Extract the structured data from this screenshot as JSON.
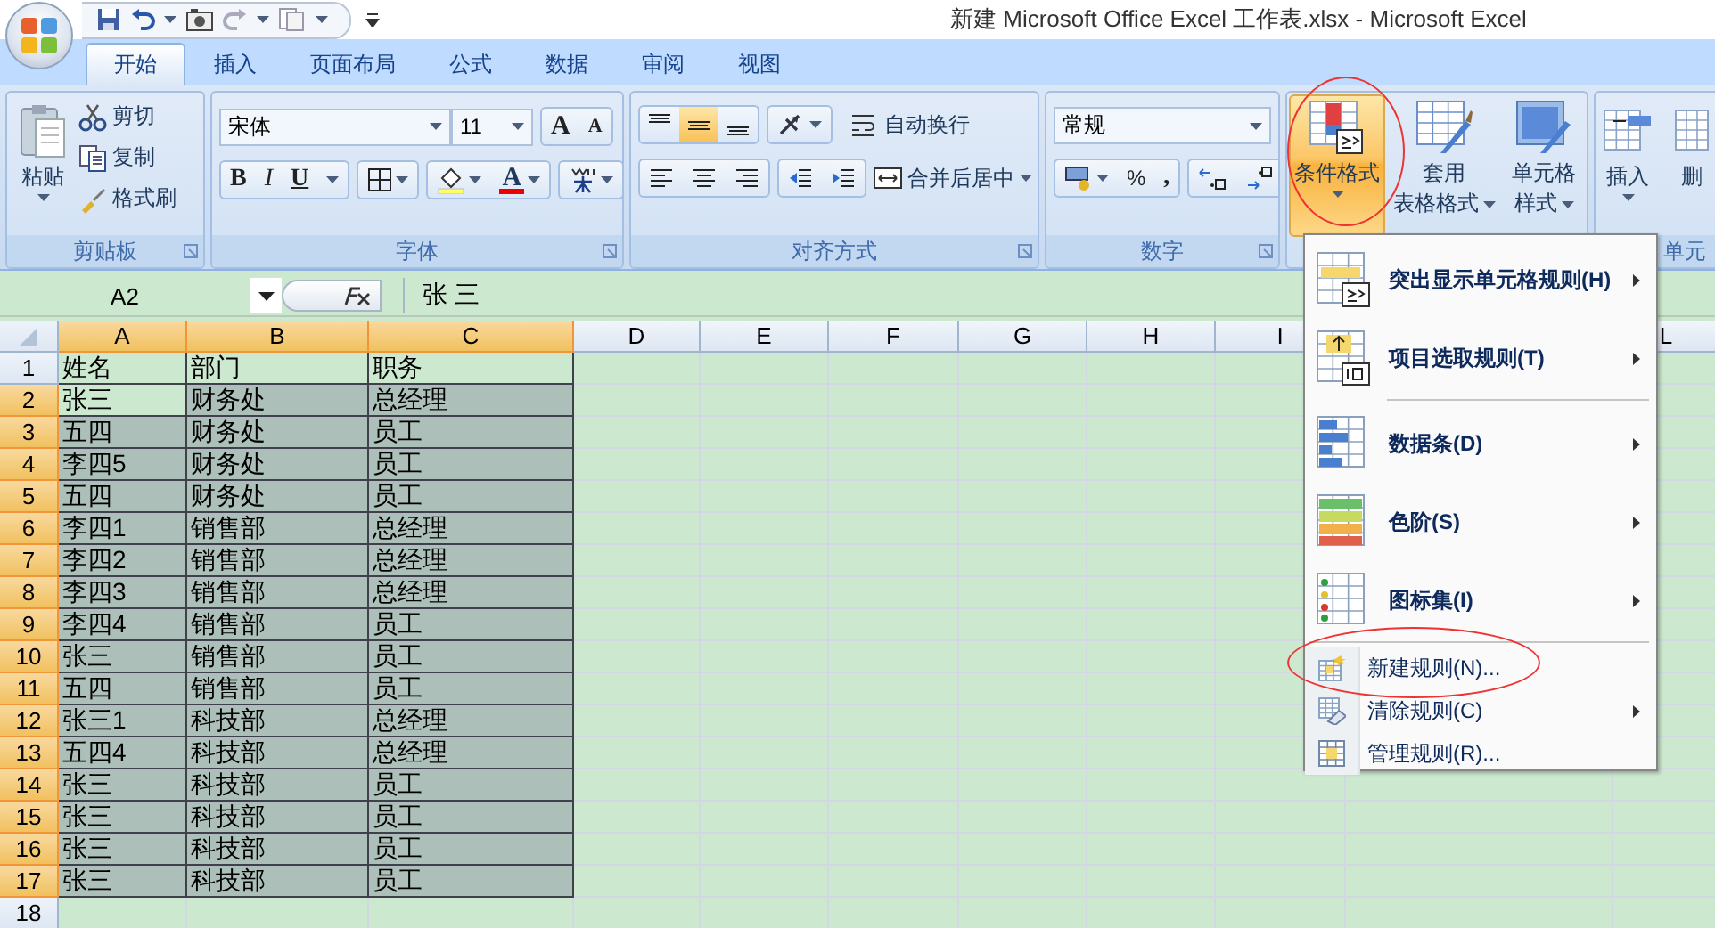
{
  "title_bar": {
    "title": "新建 Microsoft Office Excel 工作表.xlsx - Microsoft Excel"
  },
  "tabs": [
    {
      "label": "开始",
      "selected": true
    },
    {
      "label": "插入",
      "selected": false
    },
    {
      "label": "页面布局",
      "selected": false
    },
    {
      "label": "公式",
      "selected": false
    },
    {
      "label": "数据",
      "selected": false
    },
    {
      "label": "审阅",
      "selected": false
    },
    {
      "label": "视图",
      "selected": false
    }
  ],
  "ribbon": {
    "clipboard": {
      "title": "剪贴板",
      "paste": "粘贴",
      "cut": "剪切",
      "copy": "复制",
      "format_painter": "格式刷"
    },
    "font": {
      "title": "字体",
      "font_name": "宋体",
      "font_size": "11",
      "grow": "A",
      "shrink": "A",
      "bold": "B",
      "italic": "I",
      "underline": "U",
      "font_color": "A"
    },
    "alignment": {
      "title": "对齐方式",
      "vertical": [
        {
          "selected": false
        },
        {
          "selected": true
        },
        {
          "selected": false
        }
      ],
      "wrap_text": "自动换行",
      "merge_center": "合并后居中"
    },
    "number": {
      "title": "数字",
      "format": "常规",
      "percent": "%",
      "comma": ","
    },
    "styles": {
      "conditional_format": "条件格式",
      "format_as_table": [
        "套用",
        "表格格式"
      ],
      "cell_styles": [
        "单元格",
        "样式"
      ]
    },
    "cells": {
      "title": "单元",
      "insert": "插入",
      "delete": "删"
    }
  },
  "formula_bar": {
    "name_box": "A2",
    "content": "张 三"
  },
  "columns": [
    {
      "label": "A",
      "selected": true
    },
    {
      "label": "B",
      "selected": true
    },
    {
      "label": "C",
      "selected": true
    },
    {
      "label": "D",
      "selected": false
    },
    {
      "label": "E",
      "selected": false
    },
    {
      "label": "F",
      "selected": false
    },
    {
      "label": "G",
      "selected": false
    },
    {
      "label": "H",
      "selected": false
    },
    {
      "label": "I",
      "selected": false
    },
    {
      "label": "L",
      "selected": false
    }
  ],
  "rows": [
    {
      "number": "1",
      "selected": false,
      "cells": [
        "姓名",
        "部门",
        "职务"
      ]
    },
    {
      "number": "2",
      "selected": true,
      "active": true,
      "cells": [
        "张三",
        "财务处",
        "总经理"
      ]
    },
    {
      "number": "3",
      "selected": true,
      "cells": [
        "五四",
        "财务处",
        "员工"
      ]
    },
    {
      "number": "4",
      "selected": true,
      "cells": [
        "李四5",
        "财务处",
        "员工"
      ]
    },
    {
      "number": "5",
      "selected": true,
      "cells": [
        "五四",
        "财务处",
        "员工"
      ]
    },
    {
      "number": "6",
      "selected": true,
      "cells": [
        "李四1",
        "销售部",
        "总经理"
      ]
    },
    {
      "number": "7",
      "selected": true,
      "cells": [
        "李四2",
        "销售部",
        "总经理"
      ]
    },
    {
      "number": "8",
      "selected": true,
      "cells": [
        "李四3",
        "销售部",
        "总经理"
      ]
    },
    {
      "number": "9",
      "selected": true,
      "cells": [
        "李四4",
        "销售部",
        "员工"
      ]
    },
    {
      "number": "10",
      "selected": true,
      "cells": [
        "张三",
        "销售部",
        "员工"
      ]
    },
    {
      "number": "11",
      "selected": true,
      "cells": [
        "五四",
        "销售部",
        "员工"
      ]
    },
    {
      "number": "12",
      "selected": true,
      "cells": [
        "张三1",
        "科技部",
        "总经理"
      ]
    },
    {
      "number": "13",
      "selected": true,
      "cells": [
        "五四4",
        "科技部",
        "总经理"
      ]
    },
    {
      "number": "14",
      "selected": true,
      "cells": [
        "张三",
        "科技部",
        "员工"
      ]
    },
    {
      "number": "15",
      "selected": true,
      "cells": [
        "张三",
        "科技部",
        "员工"
      ]
    },
    {
      "number": "16",
      "selected": true,
      "cells": [
        "张三",
        "科技部",
        "员工"
      ]
    },
    {
      "number": "17",
      "selected": true,
      "cells": [
        "张三",
        "科技部",
        "员工"
      ]
    },
    {
      "number": "18",
      "selected": false
    }
  ],
  "menu": {
    "items": [
      {
        "kind": "large",
        "label": "突出显示单元格规则(H)",
        "submenu": true
      },
      {
        "kind": "large",
        "label": "项目选取规则(T)",
        "submenu": true
      },
      {
        "kind": "large",
        "label": "数据条(D)",
        "submenu": true
      },
      {
        "kind": "large",
        "label": "色阶(S)",
        "submenu": true
      },
      {
        "kind": "large",
        "label": "图标集(I)",
        "submenu": true
      },
      {
        "kind": "small",
        "label": "新建规则(N)...",
        "submenu": false
      },
      {
        "kind": "small",
        "label": "清除规则(C)",
        "submenu": true
      },
      {
        "kind": "small",
        "label": "管理规则(R)...",
        "submenu": false
      }
    ]
  }
}
